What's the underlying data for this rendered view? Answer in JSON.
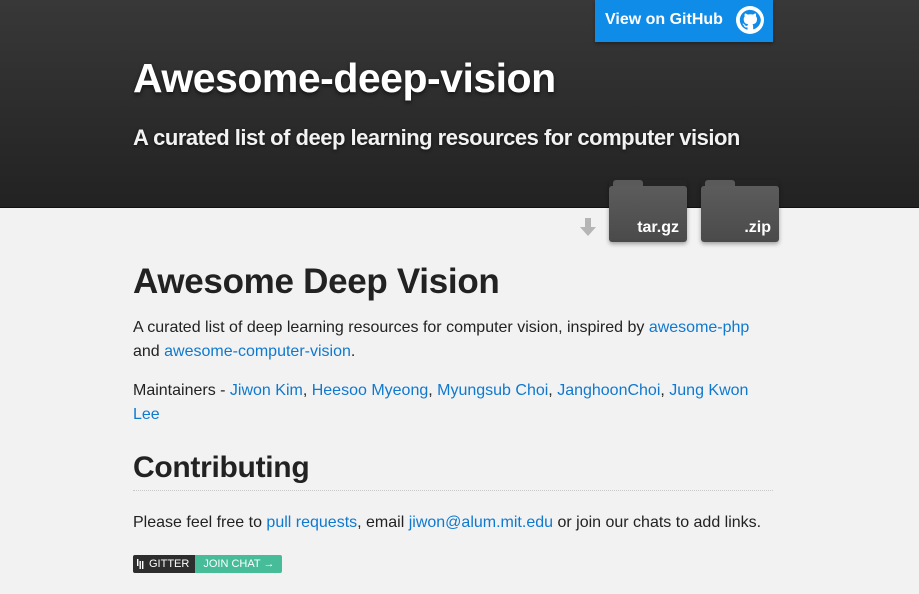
{
  "header": {
    "github_button": "View on GitHub",
    "title": "Awesome-deep-vision",
    "tagline": "A curated list of deep learning resources for computer vision"
  },
  "downloads": {
    "tar_label": "tar.gz",
    "zip_label": ".zip"
  },
  "main": {
    "heading": "Awesome Deep Vision",
    "intro_prefix": "A curated list of deep learning resources for computer vision, inspired by ",
    "intro_link1": "awesome-php",
    "intro_mid": " and ",
    "intro_link2": "awesome-computer-vision",
    "intro_suffix": ".",
    "maintainers_prefix": "Maintainers - ",
    "maintainers": [
      "Jiwon Kim",
      "Heesoo Myeong",
      "Myungsub Choi",
      "JanghoonChoi",
      "Jung Kwon Lee"
    ],
    "contributing_heading": "Contributing",
    "contrib_prefix": "Please feel free to ",
    "contrib_link1": "pull requests",
    "contrib_mid": ", email ",
    "contrib_email": "jiwon@alum.mit.edu",
    "contrib_suffix": " or join our chats to add links.",
    "gitter_left": "GITTER",
    "gitter_right": "JOIN CHAT →"
  },
  "colors": {
    "link": "#0f79d0",
    "github_button": "#0f8ce8",
    "header_bg": "#2b2b2b",
    "gitter_join": "#46bc99"
  }
}
